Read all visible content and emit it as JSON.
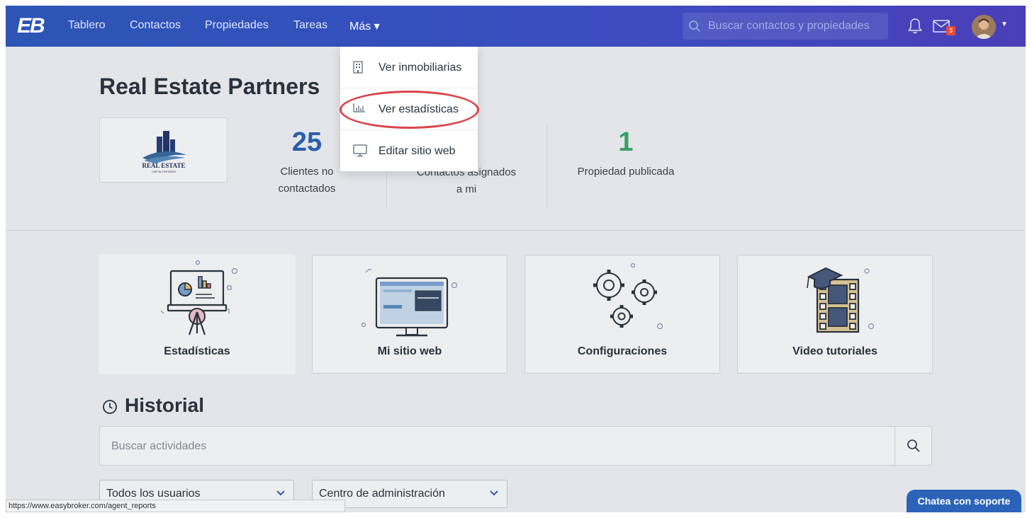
{
  "nav": {
    "logo": "EB",
    "links": [
      "Tablero",
      "Contactos",
      "Propiedades",
      "Tareas"
    ],
    "more_label": "Más ▾",
    "search_placeholder": "Buscar contactos y propiedades",
    "mail_badge": "3"
  },
  "dropdown": {
    "items": [
      {
        "label": "Ver inmobiliarias",
        "icon": "building-icon"
      },
      {
        "label": "Ver estadísticas",
        "icon": "bar-chart-icon"
      },
      {
        "label": "Editar sitio web",
        "icon": "monitor-icon"
      }
    ]
  },
  "company": {
    "name": "Real Estate Partners",
    "logo_text": "REAL ESTATE",
    "logo_subtext": "CAPITAL PARTNERS"
  },
  "stats": [
    {
      "value": "25",
      "label_line1": "Clientes no",
      "label_line2": "contactados",
      "color": "#2c63b9"
    },
    {
      "value": "",
      "label_line1": "Contactos asignados",
      "label_line2": "a mi",
      "color": "#2c63b9"
    },
    {
      "value": "1",
      "label_line1": "Propiedad publicada",
      "label_line2": "",
      "color": "#3bab6b"
    }
  ],
  "tiles": [
    {
      "label": "Estadísticas"
    },
    {
      "label": "Mi sitio web"
    },
    {
      "label": "Configuraciones"
    },
    {
      "label": "Video tutoriales"
    }
  ],
  "historial": {
    "title": "Historial",
    "search_placeholder": "Buscar actividades",
    "user_filter": "Todos los usuarios",
    "area_filter": "Centro de administración"
  },
  "chat_label": "Chatea con soporte",
  "status_url": "https://www.easybroker.com/agent_reports"
}
